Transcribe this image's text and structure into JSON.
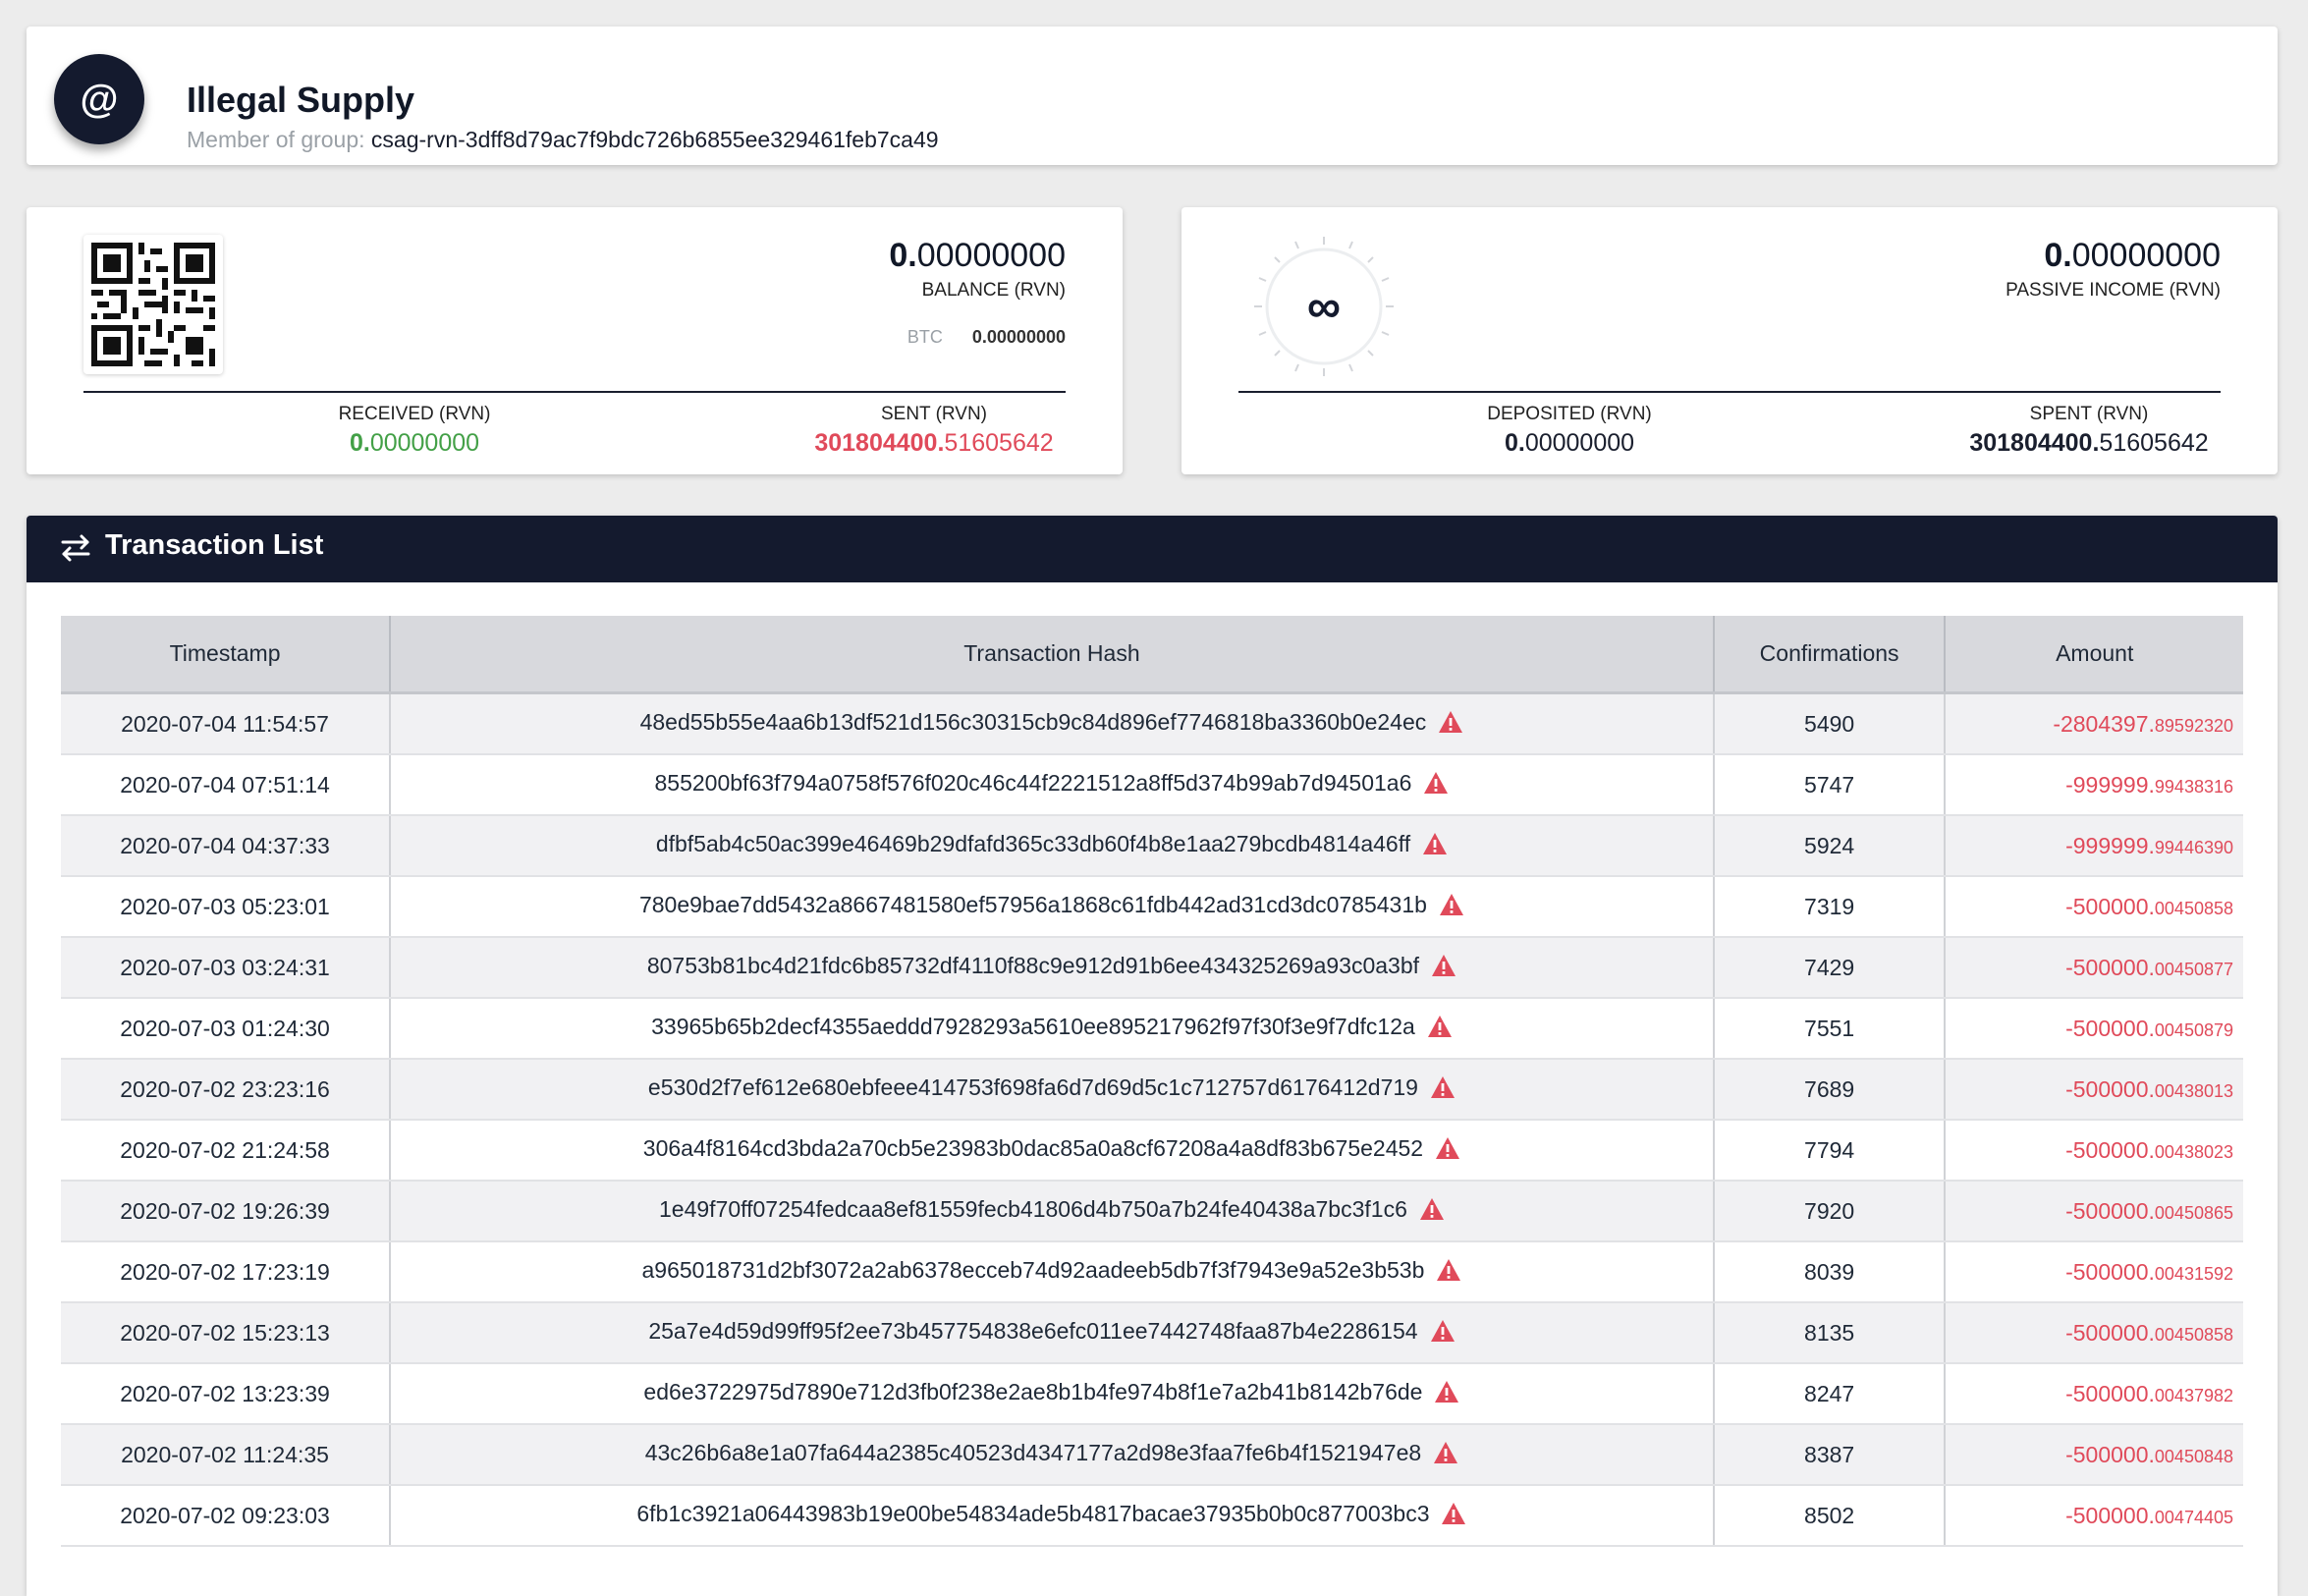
{
  "header": {
    "avatar_glyph": "@",
    "title": "Illegal Supply",
    "group_label": "Member of group:",
    "group_value": "csag-rvn-3dff8d79ac7f9bdc726b6855ee329461feb7ca49"
  },
  "balance_card": {
    "balance_int": "0.",
    "balance_dec": "00000000",
    "balance_label": "BALANCE (RVN)",
    "btc_label": "BTC",
    "btc_value": "0.00000000",
    "received_label": "RECEIVED (RVN)",
    "received_int": "0.",
    "received_dec": "00000000",
    "sent_label": "SENT (RVN)",
    "sent_int": "301804400.",
    "sent_dec": "51605642"
  },
  "passive_card": {
    "symbol": "∞",
    "income_int": "0.",
    "income_dec": "00000000",
    "income_label": "PASSIVE INCOME (RVN)",
    "deposited_label": "DEPOSITED (RVN)",
    "deposited_int": "0.",
    "deposited_dec": "00000000",
    "spent_label": "SPENT (RVN)",
    "spent_int": "301804400.",
    "spent_dec": "51605642"
  },
  "tx_panel": {
    "title": "Transaction List",
    "columns": [
      "Timestamp",
      "Transaction Hash",
      "Confirmations",
      "Amount"
    ],
    "rows": [
      {
        "ts": "2020-07-04 11:54:57",
        "hash": "48ed55b55e4aa6b13df521d156c30315cb9c84d896ef7746818ba3360b0e24ec",
        "conf": "5490",
        "amt_int": "-2804397.",
        "amt_dec": "89592320"
      },
      {
        "ts": "2020-07-04 07:51:14",
        "hash": "855200bf63f794a0758f576f020c46c44f2221512a8ff5d374b99ab7d94501a6",
        "conf": "5747",
        "amt_int": "-999999.",
        "amt_dec": "99438316"
      },
      {
        "ts": "2020-07-04 04:37:33",
        "hash": "dfbf5ab4c50ac399e46469b29dfafd365c33db60f4b8e1aa279bcdb4814a46ff",
        "conf": "5924",
        "amt_int": "-999999.",
        "amt_dec": "99446390"
      },
      {
        "ts": "2020-07-03 05:23:01",
        "hash": "780e9bae7dd5432a8667481580ef57956a1868c61fdb442ad31cd3dc0785431b",
        "conf": "7319",
        "amt_int": "-500000.",
        "amt_dec": "00450858"
      },
      {
        "ts": "2020-07-03 03:24:31",
        "hash": "80753b81bc4d21fdc6b85732df4110f88c9e912d91b6ee434325269a93c0a3bf",
        "conf": "7429",
        "amt_int": "-500000.",
        "amt_dec": "00450877"
      },
      {
        "ts": "2020-07-03 01:24:30",
        "hash": "33965b65b2decf4355aeddd7928293a5610ee895217962f97f30f3e9f7dfc12a",
        "conf": "7551",
        "amt_int": "-500000.",
        "amt_dec": "00450879"
      },
      {
        "ts": "2020-07-02 23:23:16",
        "hash": "e530d2f7ef612e680ebfeee414753f698fa6d7d69d5c1c712757d6176412d719",
        "conf": "7689",
        "amt_int": "-500000.",
        "amt_dec": "00438013"
      },
      {
        "ts": "2020-07-02 21:24:58",
        "hash": "306a4f8164cd3bda2a70cb5e23983b0dac85a0a8cf67208a4a8df83b675e2452",
        "conf": "7794",
        "amt_int": "-500000.",
        "amt_dec": "00438023"
      },
      {
        "ts": "2020-07-02 19:26:39",
        "hash": "1e49f70ff07254fedcaa8ef81559fecb41806d4b750a7b24fe40438a7bc3f1c6",
        "conf": "7920",
        "amt_int": "-500000.",
        "amt_dec": "00450865"
      },
      {
        "ts": "2020-07-02 17:23:19",
        "hash": "a965018731d2bf3072a2ab6378ecceb74d92aadeeb5db7f3f7943e9a52e3b53b",
        "conf": "8039",
        "amt_int": "-500000.",
        "amt_dec": "00431592"
      },
      {
        "ts": "2020-07-02 15:23:13",
        "hash": "25a7e4d59d99ff95f2ee73b457754838e6efc011ee7442748faa87b4e2286154",
        "conf": "8135",
        "amt_int": "-500000.",
        "amt_dec": "00450858"
      },
      {
        "ts": "2020-07-02 13:23:39",
        "hash": "ed6e3722975d7890e712d3fb0f238e2ae8b1b4fe974b8f1e7a2b41b8142b76de",
        "conf": "8247",
        "amt_int": "-500000.",
        "amt_dec": "00437982"
      },
      {
        "ts": "2020-07-02 11:24:35",
        "hash": "43c26b6a8e1a07fa644a2385c40523d4347177a2d98e3faa7fe6b4f1521947e8",
        "conf": "8387",
        "amt_int": "-500000.",
        "amt_dec": "00450848"
      },
      {
        "ts": "2020-07-02 09:23:03",
        "hash": "6fb1c3921a06443983b19e00be54834ade5b4817bacae37935b0b0c877003bc3",
        "conf": "8502",
        "amt_int": "-500000.",
        "amt_dec": "00474405"
      }
    ]
  },
  "colors": {
    "navy": "#141a2e",
    "green": "#43a047",
    "red": "#e04a5a",
    "background": "#ececec"
  }
}
